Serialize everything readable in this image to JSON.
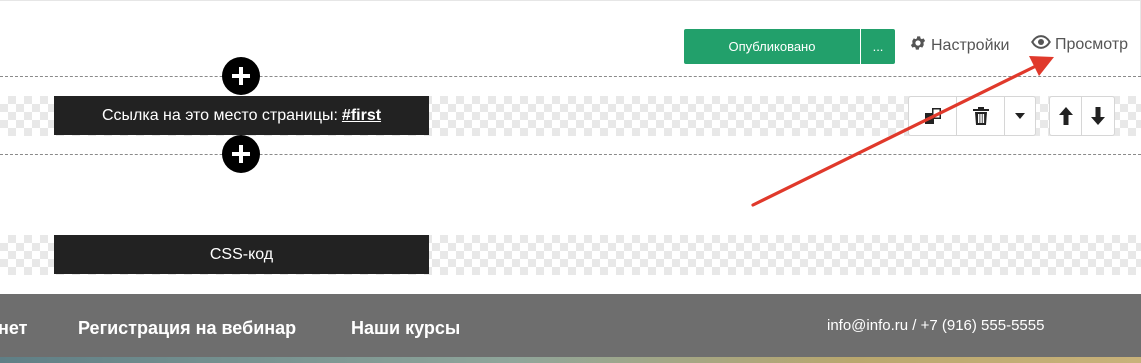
{
  "toolbar": {
    "published_label": "Опубликовано",
    "more_label": "...",
    "settings_label": "Настройки",
    "preview_label": "Просмотр"
  },
  "blocks": {
    "anchor_prefix": "Ссылка на это место страницы:",
    "anchor_link": "#first",
    "css_label": "CSS-код"
  },
  "footer": {
    "nav": [
      "нет",
      "Регистрация на вебинар",
      "Наши курсы"
    ],
    "contact": "info@info.ru / +7 (916) 555-5555"
  },
  "colors": {
    "accent_green": "#22a06b",
    "annotation_red": "#e0392b",
    "footer_bg": "#6e6e6e"
  }
}
